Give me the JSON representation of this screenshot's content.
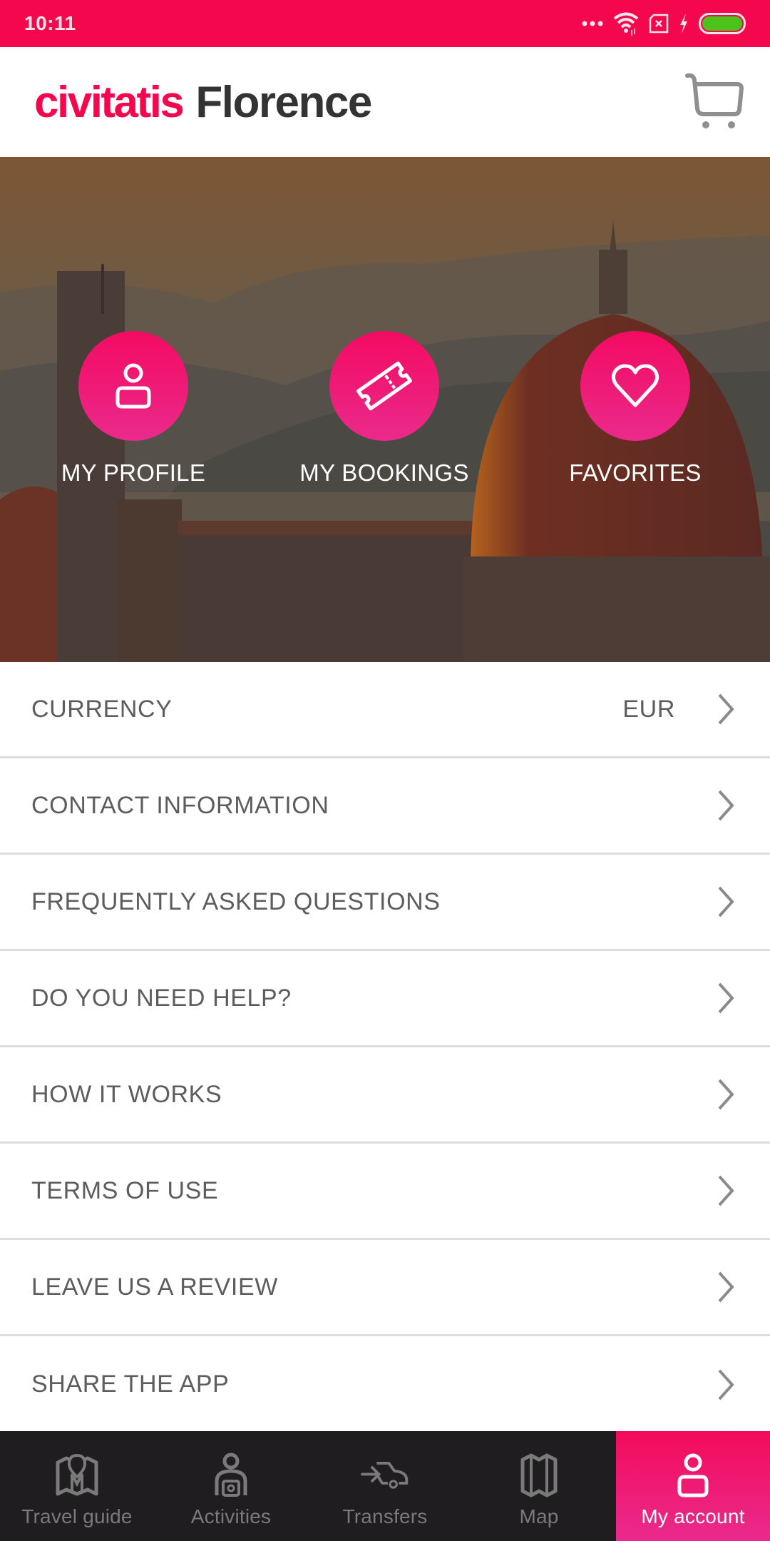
{
  "status_bar": {
    "time": "10:11",
    "icons": [
      "more-dots-icon",
      "wifi-icon",
      "sim-missing-icon",
      "charging-bolt-icon",
      "battery-icon"
    ],
    "battery_color": "#4cc21a"
  },
  "header": {
    "brand": "civitatis",
    "city": "Florence",
    "cart_icon": "shopping-cart-icon",
    "brand_color": "#f5074d"
  },
  "hero": {
    "background": "Florence cathedral dome at sunset",
    "actions": [
      {
        "label": "MY PROFILE",
        "icon": "user-icon"
      },
      {
        "label": "MY BOOKINGS",
        "icon": "ticket-icon"
      },
      {
        "label": "FAVORITES",
        "icon": "heart-icon"
      }
    ]
  },
  "menu": {
    "items": [
      {
        "label": "CURRENCY",
        "value": "EUR"
      },
      {
        "label": "CONTACT INFORMATION"
      },
      {
        "label": "FREQUENTLY ASKED QUESTIONS"
      },
      {
        "label": "DO YOU NEED HELP?"
      },
      {
        "label": "HOW IT WORKS"
      },
      {
        "label": "TERMS OF USE"
      },
      {
        "label": "LEAVE US A REVIEW"
      },
      {
        "label": "SHARE THE APP"
      }
    ]
  },
  "bottom_nav": {
    "items": [
      {
        "label": "Travel guide",
        "icon": "guide-map-icon",
        "active": false
      },
      {
        "label": "Activities",
        "icon": "activities-person-icon",
        "active": false
      },
      {
        "label": "Transfers",
        "icon": "transfer-car-icon",
        "active": false
      },
      {
        "label": "Map",
        "icon": "map-icon",
        "active": false
      },
      {
        "label": "My account",
        "icon": "user-icon",
        "active": true
      }
    ],
    "active_color": "#f30b5a"
  }
}
